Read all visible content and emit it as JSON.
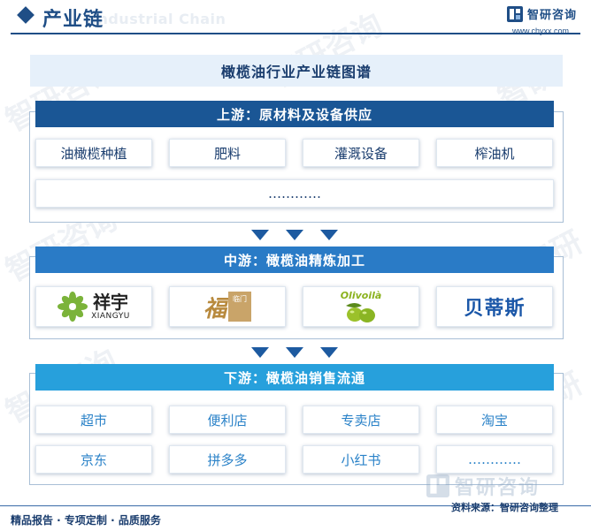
{
  "header": {
    "title": "产业链",
    "subtitle": "Industrial Chain",
    "brand": "智研咨询",
    "url": "www.chyxx.com"
  },
  "diagram": {
    "title": "橄榄油行业产业链图谱",
    "upstream": {
      "heading": "上游：原材料及设备供应",
      "row1": [
        "油橄榄种植",
        "肥料",
        "灌溉设备",
        "榨油机"
      ],
      "row2": "…………"
    },
    "midstream": {
      "heading": "中游：橄榄油精炼加工",
      "logos": {
        "xiangyu_cn": "祥宇",
        "xiangyu_en": "XIANGYU",
        "fu_char": "福",
        "fu_sub": "临门",
        "olivoila": "Olivoilà",
        "betis": "贝蒂斯"
      }
    },
    "downstream": {
      "heading": "下游：橄榄油销售流通",
      "row1": [
        "超市",
        "便利店",
        "专卖店",
        "淘宝"
      ],
      "row2": [
        "京东",
        "拼多多",
        "小红书",
        "…………"
      ]
    }
  },
  "footer": {
    "left": "精品报告 · 专项定制 · 品质服务",
    "source": "资料来源：智研咨询整理",
    "watermark": "智研咨询"
  },
  "colors": {
    "navy": "#1a3d6e",
    "upstream": "#1a5695",
    "midstream": "#2a7bc6",
    "downstream": "#27a0dc",
    "olive_green": "#8bb21e",
    "betis_blue": "#1b57a8"
  }
}
